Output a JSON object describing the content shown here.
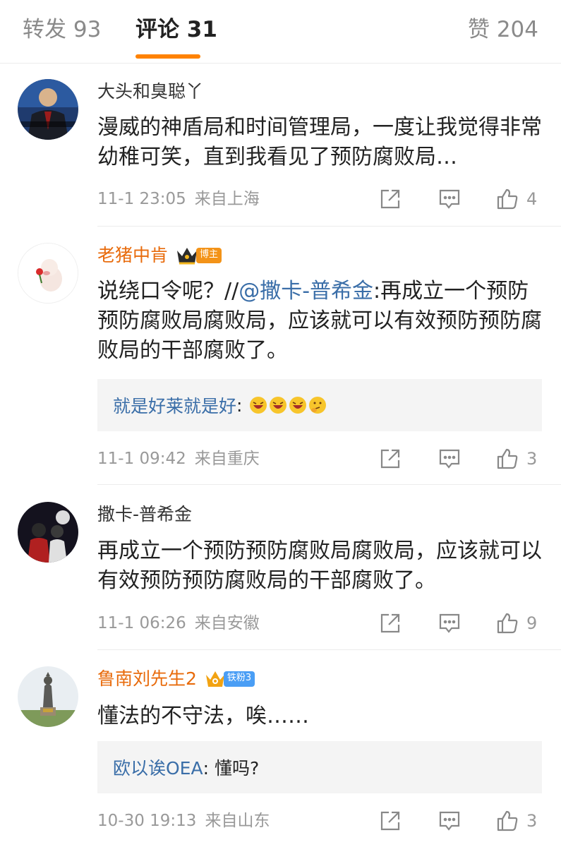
{
  "tabs": {
    "repost": "转发 93",
    "comment": "评论 31",
    "like": "赞 204"
  },
  "comments": [
    {
      "name": "大头和臭聪丫",
      "text": "漫威的神盾局和时间管理局，一度让我觉得非常幼稚可笑，直到我看见了预防腐败局…",
      "time": "11-1 23:05",
      "source": "来自上海",
      "likes": "4"
    },
    {
      "name": "老猪中肯",
      "badge": "博主",
      "text_prefix": "说绕口令呢？//",
      "mention": "@撒卡-普希金",
      "text_suffix": ":再成立一个预防预防腐败局腐败局，应该就可以有效预防预防腐败局的干部腐败了。",
      "reply_name": "就是好莱就是好",
      "reply_sep": ":",
      "time": "11-1 09:42",
      "source": "来自重庆",
      "likes": "3"
    },
    {
      "name": "撒卡-普希金",
      "text": "再成立一个预防预防腐败局腐败局，应该就可以有效预防预防腐败局的干部腐败了。",
      "time": "11-1 06:26",
      "source": "来自安徽",
      "likes": "9"
    },
    {
      "name": "鲁南刘先生2",
      "badge": "铁粉3",
      "text": "懂法的不守法，唉……",
      "reply_name": "欧以诶OEA",
      "reply_text": ": 懂吗?",
      "time": "10-30 19:13",
      "source": "来自山东",
      "likes": "3"
    }
  ],
  "icons": [
    "share-icon",
    "comment-icon",
    "thumbs-up-icon",
    "laughing-emoji-icon",
    "thinking-emoji-icon",
    "crown-icon"
  ],
  "colors": {
    "accent": "#ff8200",
    "vip_name": "#e86b0c",
    "link": "#3a6ea8",
    "meta": "#999999"
  }
}
